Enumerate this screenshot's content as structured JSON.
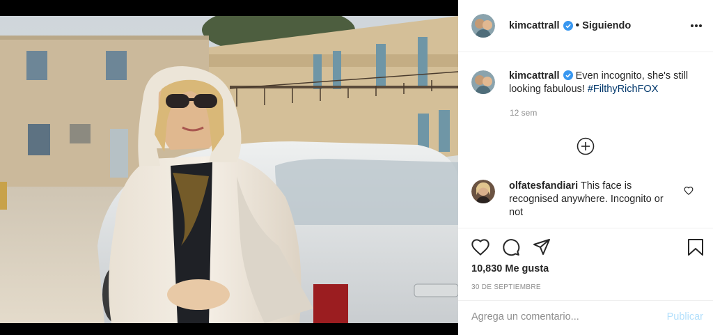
{
  "post": {
    "username": "kimcattrall",
    "follow_status": "Siguiendo",
    "separator": "•",
    "caption": "Even incognito, she's still looking fabulous! ",
    "hashtag": "#FilthyRichFOX",
    "time_ago": "12 sem",
    "likes": "10,830 Me gusta",
    "date": "30 DE SEPTIEMBRE"
  },
  "comment": {
    "username": "olfatesfandiari",
    "text": "This face is recognised anywhere. Incognito or not"
  },
  "add_comment": {
    "placeholder": "Agrega un comentario...",
    "publish_label": "Publicar"
  },
  "colors": {
    "verified": "#3897f0",
    "hashtag": "#00376b",
    "publish": "#b2dffc",
    "meta_gray": "#8e8e8e"
  },
  "icons": [
    "more-options-icon",
    "verified-icon",
    "add-circle-icon",
    "heart-icon",
    "comment-icon",
    "share-icon",
    "bookmark-icon"
  ]
}
